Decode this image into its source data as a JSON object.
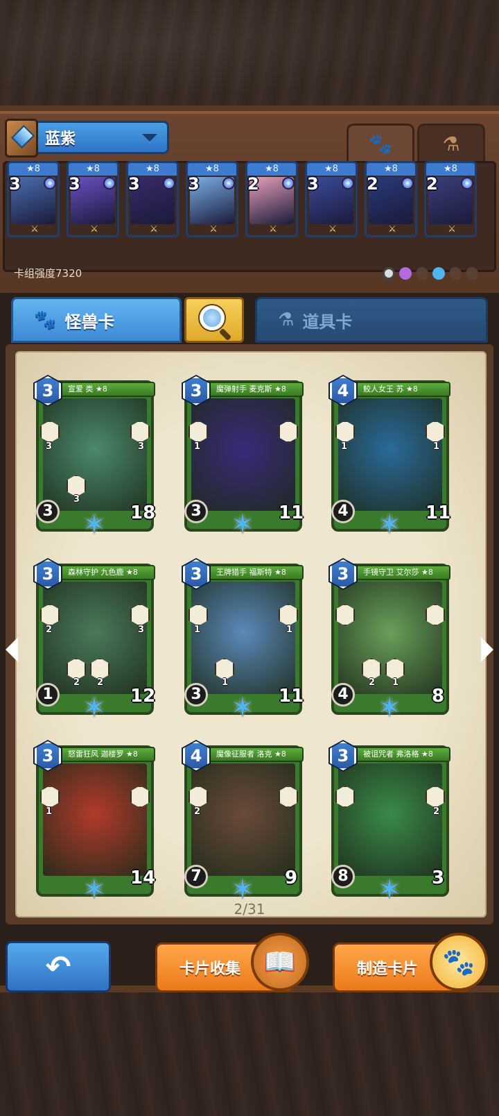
{
  "deck": {
    "name": "蓝紫",
    "strength_label": "卡组强度7320",
    "cards": [
      {
        "cost": "3",
        "stars": "★8",
        "art_color": "#4a6fb0"
      },
      {
        "cost": "3",
        "stars": "★8",
        "art_color": "#6b4fc2"
      },
      {
        "cost": "3",
        "stars": "★8",
        "art_color": "#3a2a6a"
      },
      {
        "cost": "3",
        "stars": "★8",
        "art_color": "#7ab0e8"
      },
      {
        "cost": "2",
        "stars": "★8",
        "art_color": "#e8a0b8"
      },
      {
        "cost": "3",
        "stars": "★8",
        "art_color": "#3b4b9a"
      },
      {
        "cost": "2",
        "stars": "★8",
        "art_color": "#2a3a7a"
      },
      {
        "cost": "2",
        "stars": "★8",
        "art_color": "#3a3f7a"
      }
    ]
  },
  "top_tabs": {
    "monster_icon": "paw-icon",
    "item_icon": "flask-icon"
  },
  "tabs": {
    "monster_label": "怪兽卡",
    "item_label": "道具卡"
  },
  "cards": [
    {
      "name": "宣爱 类 ★8",
      "cost": "3",
      "atk": "3",
      "hp": "18",
      "left_val": "3",
      "right_val": "3",
      "ability_nums": [
        "3"
      ],
      "art_color": "#4a8a6a"
    },
    {
      "name": "魔弹射手 麦克斯 ★8",
      "cost": "3",
      "atk": "3",
      "hp": "11",
      "left_val": "1",
      "right_val": "",
      "ability_nums": [],
      "art_color": "#3a2a7a"
    },
    {
      "name": "鲛人女王 苏 ★8",
      "cost": "4",
      "atk": "4",
      "hp": "11",
      "left_val": "1",
      "right_val": "1",
      "ability_nums": [],
      "art_color": "#2a6a9a"
    },
    {
      "name": "森林守护 九色鹿 ★8",
      "cost": "3",
      "atk": "1",
      "hp": "12",
      "left_val": "2",
      "right_val": "3",
      "ability_nums": [
        "2",
        "2"
      ],
      "art_color": "#4a7a5a"
    },
    {
      "name": "王牌猎手 福斯特 ★8",
      "cost": "3",
      "atk": "3",
      "hp": "11",
      "left_val": "1",
      "right_val": "1",
      "ability_nums": [
        "1"
      ],
      "art_color": "#5a8aba"
    },
    {
      "name": "手镜守卫 艾尔莎 ★8",
      "cost": "3",
      "atk": "4",
      "hp": "8",
      "left_val": "",
      "right_val": "",
      "ability_nums": [
        "2",
        "1"
      ],
      "art_color": "#6aa05a"
    },
    {
      "name": "怒雷狂风 迦楼罗 ★8",
      "cost": "3",
      "atk": "",
      "hp": "14",
      "left_val": "1",
      "right_val": "",
      "ability_nums": [],
      "art_color": "#b23a2a"
    },
    {
      "name": "魔像征服者 洛克 ★8",
      "cost": "4",
      "atk": "7",
      "hp": "9",
      "left_val": "2",
      "right_val": "",
      "ability_nums": [],
      "art_color": "#6a4a3a"
    },
    {
      "name": "被诅咒者 弗洛格 ★8",
      "cost": "3",
      "atk": "8",
      "hp": "3",
      "left_val": "",
      "right_val": "2",
      "ability_nums": [],
      "art_color": "#3a8a4a"
    }
  ],
  "pagination": "2/31",
  "buttons": {
    "back_icon": "back-arrow-icon",
    "collect_label": "卡片收集",
    "craft_label": "制造卡片"
  }
}
